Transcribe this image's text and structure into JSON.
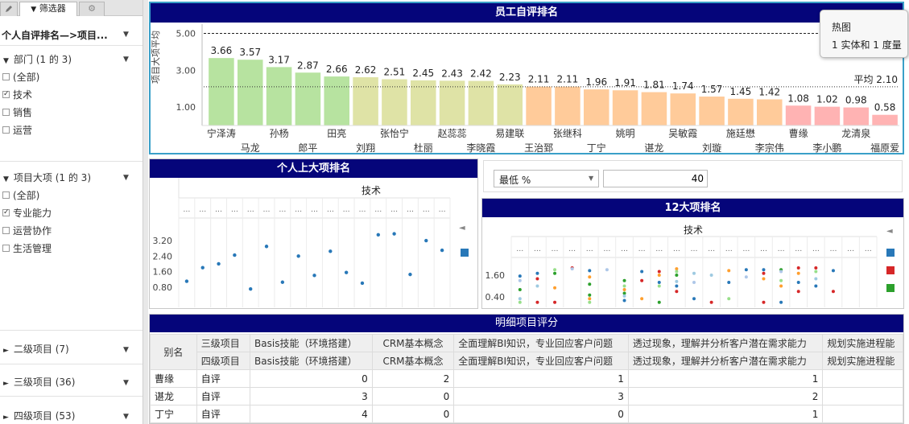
{
  "left_pane": {
    "tabs": [
      {
        "label": "筛选器"
      }
    ],
    "title": "个人自评排名—>项目...",
    "groups": [
      {
        "label": "部门 (1 的 3)",
        "options": [
          {
            "label": "(全部)",
            "checked": false
          },
          {
            "label": "技术",
            "checked": true
          },
          {
            "label": "销售",
            "checked": false
          },
          {
            "label": "运营",
            "checked": false
          }
        ]
      },
      {
        "label": "项目大项 (1 的 3)",
        "options": [
          {
            "label": "(全部)",
            "checked": false
          },
          {
            "label": "专业能力",
            "checked": true
          },
          {
            "label": "运营协作",
            "checked": false
          },
          {
            "label": "生活管理",
            "checked": false
          }
        ]
      }
    ],
    "collapsed": [
      {
        "label": "二级项目 (7)"
      },
      {
        "label": "三级项目 (36)"
      },
      {
        "label": "四级项目 (53)"
      }
    ]
  },
  "tooltip": {
    "line1": "热图",
    "line2": "1 实体和 1 度量"
  },
  "control": {
    "select_value": "最低 %",
    "input_value": "40"
  },
  "main_chart": {
    "title": "员工自评排名",
    "ylabel": "项目大项平均",
    "average_label": "平均 2.10",
    "average_value": 2.1,
    "ref_line_value": 5.0,
    "y_ticks": [
      "5.00",
      "3.00",
      "1.00"
    ],
    "colors": {
      "green": "#b7e3a0",
      "yellow": "#dfe3a6",
      "orange": "#ffcb9a",
      "pink": "#ffb3b3"
    }
  },
  "chart_data": [
    {
      "type": "bar",
      "title": "员工自评排名",
      "ylabel": "项目大项平均",
      "ylim": [
        0,
        5.5
      ],
      "categories": [
        "宁泽涛",
        "马龙",
        "孙杨",
        "郎平",
        "田亮",
        "刘翔",
        "张怡宁",
        "杜丽",
        "赵蕊蕊",
        "李晓霞",
        "易建联",
        "王治郅",
        "张继科",
        "丁宁",
        "姚明",
        "谌龙",
        "吴敏霞",
        "刘璇",
        "施廷懋",
        "李宗伟",
        "曹缘",
        "李小鹏",
        "龙清泉",
        "福原爱"
      ],
      "values": [
        3.66,
        3.57,
        3.17,
        2.87,
        2.66,
        2.62,
        2.51,
        2.45,
        2.43,
        2.42,
        2.23,
        2.11,
        2.11,
        1.96,
        1.91,
        1.81,
        1.74,
        1.57,
        1.45,
        1.42,
        1.08,
        1.02,
        0.98,
        0.58
      ],
      "color_group": [
        "green",
        "green",
        "green",
        "green",
        "green",
        "yellow",
        "yellow",
        "yellow",
        "yellow",
        "yellow",
        "yellow",
        "orange",
        "orange",
        "orange",
        "orange",
        "orange",
        "orange",
        "orange",
        "orange",
        "orange",
        "pink",
        "pink",
        "pink",
        "pink"
      ],
      "reference_lines": [
        {
          "label": "平均 2.10",
          "value": 2.1
        },
        {
          "value": 5.0
        }
      ]
    },
    {
      "type": "scatter",
      "title": "个人上大项排名",
      "column_header": "技术",
      "y_ticks": [
        "3.20",
        "2.40",
        "1.60",
        "0.80"
      ],
      "ylim": [
        0,
        4.2
      ],
      "values": [
        1.1,
        1.8,
        2.0,
        2.45,
        0.7,
        2.9,
        1.05,
        2.4,
        1.4,
        2.65,
        1.55,
        1.0,
        3.5,
        3.55,
        1.45,
        3.2,
        2.7
      ],
      "color": "#2878b8"
    },
    {
      "type": "scatter",
      "title": "12大项排名",
      "column_header": "技术",
      "y_ticks": [
        "1.60",
        "0.40"
      ],
      "ylim": [
        0,
        2.4
      ],
      "colors": [
        "#2878b8",
        "#d62728",
        "#2ca02c",
        "#ff9f2e",
        "#9ecae1",
        "#98df8a",
        "#aec7e8"
      ],
      "points": [
        [
          0,
          1.55,
          0
        ],
        [
          0,
          1.3,
          6
        ],
        [
          0,
          0.8,
          2
        ],
        [
          0,
          0.3,
          4
        ],
        [
          0,
          0.1,
          5
        ],
        [
          1,
          1.7,
          0
        ],
        [
          1,
          1.4,
          1
        ],
        [
          1,
          1.0,
          4
        ],
        [
          1,
          0.1,
          1
        ],
        [
          2,
          1.9,
          5
        ],
        [
          2,
          1.7,
          2
        ],
        [
          2,
          0.9,
          3
        ],
        [
          2,
          0.1,
          1
        ],
        [
          3,
          2.0,
          1
        ],
        [
          3,
          1.95,
          6
        ],
        [
          4,
          1.85,
          0
        ],
        [
          4,
          1.5,
          3
        ],
        [
          4,
          1.1,
          2
        ],
        [
          4,
          0.5,
          2
        ],
        [
          4,
          0.3,
          3
        ],
        [
          4,
          0.1,
          5
        ],
        [
          5,
          1.9,
          6
        ],
        [
          6,
          1.3,
          2
        ],
        [
          6,
          1.0,
          5
        ],
        [
          6,
          0.8,
          3
        ],
        [
          6,
          0.6,
          2
        ],
        [
          6,
          0.45,
          4
        ],
        [
          6,
          0.2,
          0
        ],
        [
          7,
          1.8,
          0
        ],
        [
          7,
          1.3,
          1
        ],
        [
          7,
          0.3,
          3
        ],
        [
          8,
          1.8,
          1
        ],
        [
          8,
          1.6,
          3
        ],
        [
          8,
          1.2,
          0
        ],
        [
          8,
          1.0,
          5
        ],
        [
          8,
          0.1,
          2
        ],
        [
          9,
          1.95,
          3
        ],
        [
          9,
          1.8,
          5
        ],
        [
          9,
          1.6,
          2
        ],
        [
          9,
          1.25,
          4
        ],
        [
          9,
          1.0,
          0
        ],
        [
          9,
          0.7,
          1
        ],
        [
          10,
          1.7,
          4
        ],
        [
          10,
          1.2,
          6
        ],
        [
          10,
          0.3,
          0
        ],
        [
          11,
          1.6,
          4
        ],
        [
          11,
          0.1,
          1
        ],
        [
          12,
          1.85,
          3
        ],
        [
          12,
          1.2,
          0
        ],
        [
          12,
          0.3,
          5
        ],
        [
          13,
          1.9,
          0
        ],
        [
          13,
          1.5,
          6
        ],
        [
          14,
          1.9,
          0
        ],
        [
          14,
          1.7,
          1
        ],
        [
          14,
          1.4,
          3
        ],
        [
          14,
          0.1,
          1
        ],
        [
          15,
          1.9,
          2
        ],
        [
          15,
          1.8,
          6
        ],
        [
          15,
          1.3,
          5
        ],
        [
          15,
          1.0,
          3
        ],
        [
          15,
          0.1,
          0
        ],
        [
          16,
          2.0,
          1
        ],
        [
          16,
          1.7,
          3
        ],
        [
          16,
          1.2,
          0
        ],
        [
          16,
          0.7,
          1
        ],
        [
          17,
          2.0,
          1
        ],
        [
          17,
          1.8,
          5
        ],
        [
          17,
          1.4,
          4
        ],
        [
          17,
          1.0,
          0
        ],
        [
          18,
          1.85,
          0
        ],
        [
          18,
          0.7,
          1
        ]
      ]
    }
  ],
  "panel_scatter1": {
    "title": "个人上大项排名",
    "column_header": "技术",
    "legend_arrow": "◄"
  },
  "panel_scatter2": {
    "title": "12大项排名",
    "column_header": "技术",
    "legend_arrow": "◄"
  },
  "table": {
    "title": "明细项目评分",
    "corner": "别名",
    "header_row1": [
      "三级项目",
      "Basis技能（环境搭建）",
      "CRM基本概念",
      "全面理解BI知识，专业回应客户问题",
      "透过现象，理解并分析客户潜在需求能力",
      "规划实施进程能"
    ],
    "header_row2": [
      "四级项目",
      "Basis技能（环境搭建）",
      "CRM基本概念",
      "全面理解BI知识，专业回应客户问题",
      "透过现象，理解并分析客户潜在需求能力",
      "规划实施进程能"
    ],
    "rows": [
      {
        "name": "曹缘",
        "type": "自评",
        "values": [
          "0",
          "2",
          "1",
          "1",
          ""
        ]
      },
      {
        "name": "谌龙",
        "type": "自评",
        "values": [
          "3",
          "0",
          "3",
          "2",
          ""
        ]
      },
      {
        "name": "丁宁",
        "type": "自评",
        "values": [
          "4",
          "0",
          "0",
          "1",
          ""
        ]
      }
    ]
  }
}
